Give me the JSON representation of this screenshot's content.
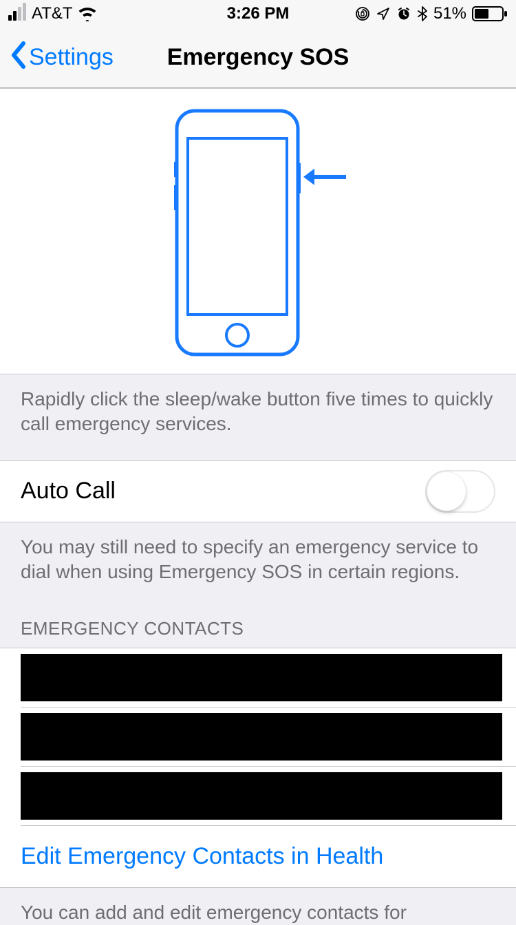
{
  "status": {
    "carrier": "AT&T",
    "time": "3:26 PM",
    "battery_pct": "51%"
  },
  "nav": {
    "back_label": "Settings",
    "title": "Emergency SOS"
  },
  "instruction": "Rapidly click the sleep/wake button five times to quickly call emergency services.",
  "auto_call": {
    "label": "Auto Call",
    "on": false,
    "footer": "You may still need to specify an emergency service to dial when using Emergency SOS in certain regions."
  },
  "contacts_section": {
    "header": "EMERGENCY CONTACTS",
    "rows": [
      "",
      "",
      ""
    ],
    "edit_label": "Edit Emergency Contacts in Health",
    "footer": "You can add and edit emergency contacts for"
  },
  "colors": {
    "accent": "#007aff",
    "bg": "#efeff4",
    "text_secondary": "#6d6d72"
  }
}
